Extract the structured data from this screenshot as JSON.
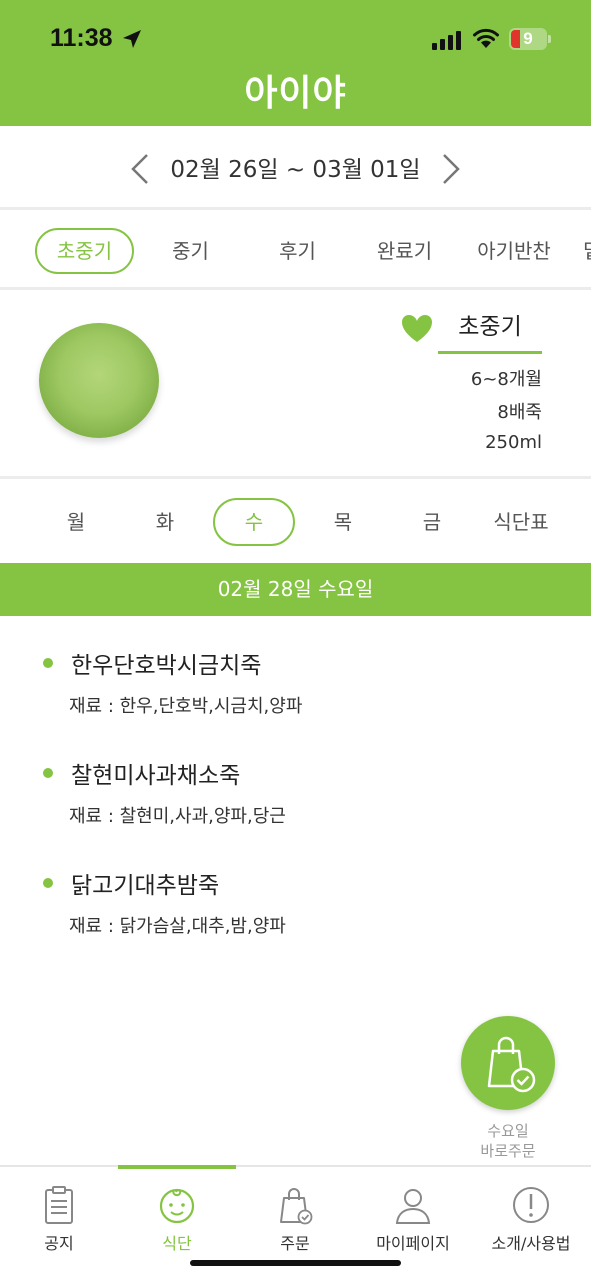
{
  "status_bar": {
    "time": "11:38",
    "battery": "9"
  },
  "app": {
    "logo": "아이야"
  },
  "week": {
    "range": "02월 26일 ~ 03월 01일"
  },
  "stage_tabs": [
    {
      "label": "초중기",
      "active": true
    },
    {
      "label": "중기",
      "active": false
    },
    {
      "label": "후기",
      "active": false
    },
    {
      "label": "완료기",
      "active": false
    },
    {
      "label": "아기반찬",
      "active": false
    },
    {
      "label": "밑",
      "active": false
    }
  ],
  "stage_info": {
    "name": "초중기",
    "age": "6~8개월",
    "ratio": "8배죽",
    "volume": "250ml"
  },
  "day_tabs": [
    {
      "label": "월",
      "active": false
    },
    {
      "label": "화",
      "active": false
    },
    {
      "label": "수",
      "active": true
    },
    {
      "label": "목",
      "active": false
    },
    {
      "label": "금",
      "active": false
    },
    {
      "label": "식단표",
      "active": false
    }
  ],
  "selected_date": "02월 28일 수요일",
  "menu": [
    {
      "name": "한우단호박시금치죽",
      "ingredients": "재료 : 한우,단호박,시금치,양파"
    },
    {
      "name": "찰현미사과채소죽",
      "ingredients": "재료 : 찰현미,사과,양파,당근"
    },
    {
      "name": "닭고기대추밤죽",
      "ingredients": "재료 : 닭가슴살,대추,밤,양파"
    }
  ],
  "quick_order": {
    "line1": "수요일",
    "line2": "바로주문",
    "icon": "shopping-bag-check-icon"
  },
  "bottom_nav": [
    {
      "label": "공지",
      "icon": "clipboard-icon",
      "active": false
    },
    {
      "label": "식단",
      "icon": "baby-face-icon",
      "active": true
    },
    {
      "label": "주문",
      "icon": "shopping-bag-icon",
      "active": false
    },
    {
      "label": "마이페이지",
      "icon": "person-icon",
      "active": false
    },
    {
      "label": "소개/사용법",
      "icon": "info-circle-icon",
      "active": false
    }
  ],
  "colors": {
    "accent": "#84c442",
    "text": "#333333",
    "divider": "#ececec"
  }
}
